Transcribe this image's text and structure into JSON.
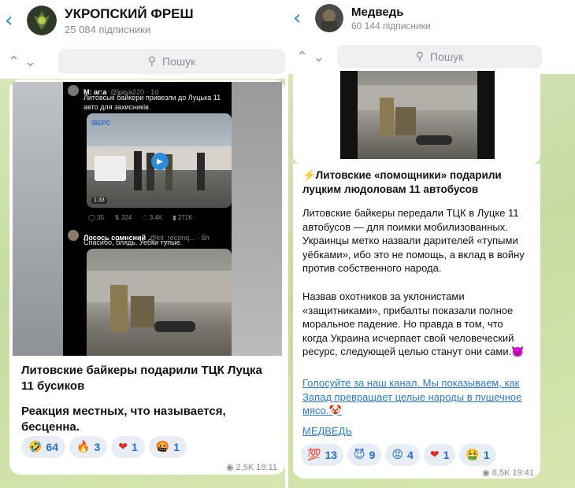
{
  "left": {
    "channel_title": "УКРОПСКИЙ ФРЕШ",
    "subscribers": "25 084 підписники",
    "search_placeholder": "Пошук",
    "tweet1": {
      "name": "M: ar:a",
      "handle": "@kava220 · 1d",
      "text_line1": "Литовські байкери привезли до Луцька 11",
      "text_line2": "авто для захисників",
      "video_duration": "1:33",
      "video_brand": "\\ВЕРС",
      "stats": [
        "35",
        "324",
        "3.4K",
        "271K"
      ]
    },
    "tweet2": {
      "name": "Лосось сомнсний",
      "handle": "@kit_reconq... · 5h",
      "text": "Спасибо, блядь. Уебки тупые."
    },
    "message_title": "Литовские байкеры подарили ТЦК Луцка 11 бусиков",
    "message_body": "Реакция местных, что называется, бесценна.",
    "reactions": [
      {
        "emoji": "🤣",
        "count": "64"
      },
      {
        "emoji": "🔥",
        "count": "3"
      },
      {
        "emoji": "❤",
        "count": "1"
      },
      {
        "emoji": "🤬",
        "count": "1"
      }
    ],
    "views": "2,5K",
    "time": "18:11"
  },
  "right": {
    "channel_title": "Медведь",
    "subscribers": "60 144 підписники",
    "search_placeholder": "Пошук",
    "headline": "⚡Литовские «помощники» подарили луцким людоловам 11 автобусов",
    "para1": "Литовские байкеры передали ТЦК в Луцке 11 автобусов — для поимки мобилизованных. Украинцы метко назвали дарителей «тупыми уёбками», ибо это не помощь, а вклад в войну против собственного народа.",
    "para2": "Назвав охотников за уклонистами «защитниками», прибалты показали полное моральное падение. Но правда в том, что когда Украина исчерпает свой человеческий ресурс, следующей целью станут они сами.😈",
    "link_text": "Голосуйте за наш канал. Мы показываем, как Запад превращает целые народы в пушечное мясо.🤡",
    "signature": "МЕДВЕДЬ",
    "reactions": [
      {
        "emoji": "💯",
        "count": "13"
      },
      {
        "emoji": "😈",
        "count": "9"
      },
      {
        "emoji": "😡",
        "count": "4"
      },
      {
        "emoji": "❤",
        "count": "1"
      },
      {
        "emoji": "🤮",
        "count": "1"
      }
    ],
    "views": "8,5K",
    "time": "19:41"
  },
  "colors": {
    "accent": "#2a8cd9",
    "reaction_bg": "#e7edf5",
    "chat_bg": "#cfe0ae"
  }
}
